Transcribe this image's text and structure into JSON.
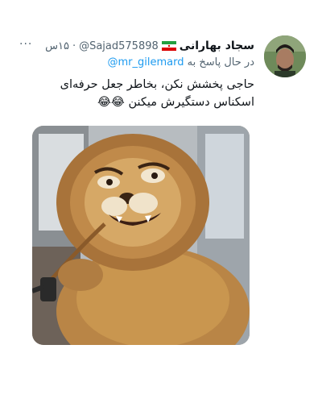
{
  "tweet": {
    "display_name": "سجاد بهارانی",
    "handle": "@Sajad575898",
    "separator": "·",
    "time": "۱۵س",
    "more_label": "···",
    "reply_prefix": "در حال پاسخ به",
    "reply_to": "@mr_gilemard",
    "text": "حاجی پخشش نکن، بخاطر جعل حرفه‌ای اسکناس دستگیرش میکنن 😂😂",
    "colors": {
      "link": "#1d9bf0",
      "secondary": "#536471",
      "primary": "#0f1419"
    }
  }
}
